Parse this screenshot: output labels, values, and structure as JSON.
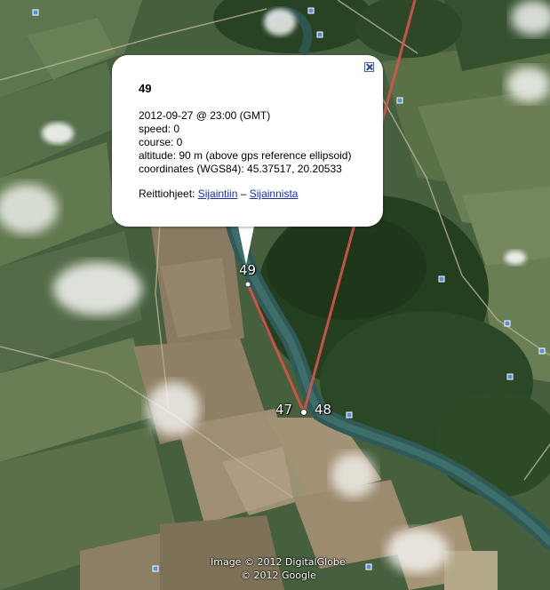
{
  "popup": {
    "title": "49",
    "datetime": "2012-09-27 @ 23:00 (GMT)",
    "speed": "speed: 0",
    "course": "course: 0",
    "altitude": "altitude: 90 m (above gps reference ellipsoid)",
    "coordinates": "coordinates (WGS84): 45.37517, 20.20533",
    "directions_prefix": "Reittiohjeet: ",
    "directions_to": "Sijaintiin",
    "directions_sep": " – ",
    "directions_from": "Sijainnista"
  },
  "waypoints": [
    {
      "label": "49",
      "lat": 45.37517,
      "lon": 20.20533
    },
    {
      "label": "47"
    },
    {
      "label": "48"
    }
  ],
  "attribution": {
    "imagery": "Image © 2012 DigitalGlobe",
    "map": "© 2012 Google"
  },
  "colors": {
    "track": "#d9534a",
    "link": "#1a2fb5"
  },
  "icons": [
    "close-icon",
    "waypoint-marker-icon",
    "place-marker-icon"
  ]
}
